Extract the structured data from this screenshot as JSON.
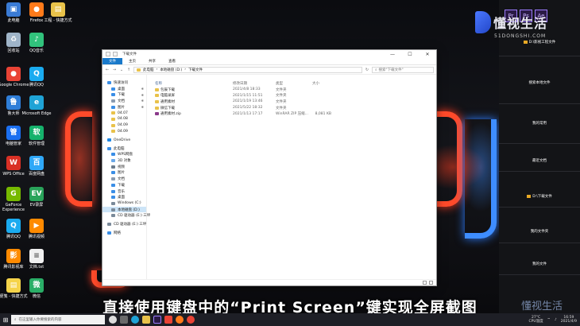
{
  "desktop_icons": [
    {
      "label": "此电脑",
      "color": "#3a7bd5",
      "glyph": "▣"
    },
    {
      "label": "回收站",
      "color": "#9fb4c8",
      "glyph": "♻"
    },
    {
      "label": "Google Chrome",
      "color": "#e94335",
      "glyph": "●"
    },
    {
      "label": "Firefox",
      "color": "#ff7a1a",
      "glyph": "●"
    },
    {
      "label": "QQ音乐",
      "color": "#31c27c",
      "glyph": "♪"
    },
    {
      "label": "腾讯QQ",
      "color": "#1aabf0",
      "glyph": "Q"
    },
    {
      "label": "工程 - 快捷方式",
      "color": "#e8c24a",
      "glyph": "▤"
    },
    {
      "label": "鲁大师",
      "color": "#2f7ed8",
      "glyph": "鲁"
    },
    {
      "label": "Microsoft Edge",
      "color": "#1fa3d6",
      "glyph": "e"
    },
    {
      "label": "电脑管家",
      "color": "#1b6ff0",
      "glyph": "管"
    },
    {
      "label": "软件管理",
      "color": "#16b26c",
      "glyph": "软"
    },
    {
      "label": "WPS Office",
      "color": "#d93025",
      "glyph": "W"
    },
    {
      "label": "百度网盘",
      "color": "#2fa8f8",
      "glyph": "百"
    },
    {
      "label": "GeForce Experience",
      "color": "#76b900",
      "glyph": "G"
    },
    {
      "label": "EV录屏",
      "color": "#29a35a",
      "glyph": "EV"
    },
    {
      "label": "腾讯QQ",
      "color": "#1aabf0",
      "glyph": "Q"
    },
    {
      "label": "腾讯视频",
      "color": "#ff8a00",
      "glyph": "▶"
    },
    {
      "label": "腾讯影视库",
      "color": "#ff8a00",
      "glyph": "影"
    },
    {
      "label": "文档.txt",
      "color": "#f0f0f0",
      "glyph": "≡"
    },
    {
      "label": "便笺 - 快捷方式",
      "color": "#f5d34a",
      "glyph": "▤"
    },
    {
      "label": "微信",
      "color": "#2aae67",
      "glyph": "微"
    }
  ],
  "explorer": {
    "title": "下载文件",
    "controls": {
      "minimize": "—",
      "maximize": "☐",
      "close": "✕"
    },
    "ribbon_tabs": [
      "文件",
      "主页",
      "共享",
      "查看"
    ],
    "address_path": [
      "此电脑",
      "本地磁盘 (D:)",
      "下载文件"
    ],
    "search_placeholder": "搜索\"下载文件\"",
    "sidebar": [
      {
        "label": "快速访问",
        "color": "#3a8ee6",
        "level": 0
      },
      {
        "label": "桌面",
        "color": "#3a8ee6",
        "level": 1,
        "pin": true
      },
      {
        "label": "下载",
        "color": "#3a8ee6",
        "level": 1,
        "pin": true
      },
      {
        "label": "文档",
        "color": "#8a9bb0",
        "level": 1,
        "pin": true
      },
      {
        "label": "图片",
        "color": "#3a8ee6",
        "level": 1,
        "pin": true
      },
      {
        "label": "04.07",
        "color": "#e9c24a",
        "level": 1
      },
      {
        "label": "04.08",
        "color": "#e9c24a",
        "level": 1
      },
      {
        "label": "04.09",
        "color": "#e9c24a",
        "level": 1
      },
      {
        "label": "04.09",
        "color": "#e9c24a",
        "level": 1
      },
      {
        "label": "OneDrive",
        "color": "#1e88e5",
        "level": 0,
        "gap": true
      },
      {
        "label": "此电脑",
        "color": "#3a8ee6",
        "level": 0,
        "gap": true
      },
      {
        "label": "WPS网盘",
        "color": "#3a8ee6",
        "level": 1
      },
      {
        "label": "3D 对象",
        "color": "#6aa8e8",
        "level": 1
      },
      {
        "label": "视频",
        "color": "#6a7b8c",
        "level": 1
      },
      {
        "label": "图片",
        "color": "#3a8ee6",
        "level": 1
      },
      {
        "label": "文档",
        "color": "#8a9bb0",
        "level": 1
      },
      {
        "label": "下载",
        "color": "#3a8ee6",
        "level": 1
      },
      {
        "label": "音乐",
        "color": "#3a8ee6",
        "level": 1
      },
      {
        "label": "桌面",
        "color": "#3a8ee6",
        "level": 1
      },
      {
        "label": "Windows (C:)",
        "color": "#7a8a9a",
        "level": 1
      },
      {
        "label": "本地磁盘 (D:)",
        "color": "#7a8a9a",
        "level": 1,
        "selected": true
      },
      {
        "label": "CD 驱动器 (E:) 三坪",
        "color": "#7a8a9a",
        "level": 1
      },
      {
        "label": "CD 驱动器 (E:) 三坪",
        "color": "#7a8a9a",
        "level": 0,
        "gap": true
      },
      {
        "label": "网络",
        "color": "#3a8ee6",
        "level": 0,
        "gap": true
      }
    ],
    "columns": [
      "名称",
      "修改日期",
      "类型",
      "大小"
    ],
    "files": [
      {
        "name": "包辰下载",
        "date": "2021/4/8 18:33",
        "type": "文件夹",
        "size": "",
        "color": "#e9c24a"
      },
      {
        "name": "电脑录屏",
        "date": "2021/1/15 11:51",
        "type": "文件夹",
        "size": "",
        "color": "#e9c24a"
      },
      {
        "name": "通用素材",
        "date": "2021/1/19 13:46",
        "type": "文件夹",
        "size": "",
        "color": "#e9c24a"
      },
      {
        "name": "微信下载",
        "date": "2021/5/22 18:32",
        "type": "文件夹",
        "size": "",
        "color": "#e9c24a"
      },
      {
        "name": "通用素材.zip",
        "date": "2021/1/13 17:17",
        "type": "WinRAR ZIP 压缩...",
        "size": "8,081 KB",
        "color": "#8b3a8b"
      }
    ]
  },
  "right_panel": {
    "title": "软件",
    "app_labels": [
      "Pr",
      "Ps",
      "Ae"
    ],
    "brand": "懂视生活",
    "brand_sub": "51DONGSHI.COM",
    "items": [
      {
        "label": "D:\\影视工程文件",
        "folder": true
      },
      {
        "label": "搜索本地文件",
        "folder": false
      },
      {
        "label": "我的常用",
        "folder": false
      },
      {
        "label": "最近文档",
        "folder": false
      },
      {
        "label": "D:\\下载文件",
        "folder": true
      },
      {
        "label": "我的文件夹",
        "folder": false
      },
      {
        "label": "我的文件",
        "folder": false
      }
    ]
  },
  "subtitle": "直接使用键盘中的“Print Screen”键实现全屏截图",
  "watermark": "懂视生活",
  "taskbar": {
    "search_placeholder": "在这里输入你要搜索的内容",
    "temperature": "27°C",
    "cpu_label": "CPU温度",
    "time": "16:59",
    "date": "2021/4/9"
  }
}
